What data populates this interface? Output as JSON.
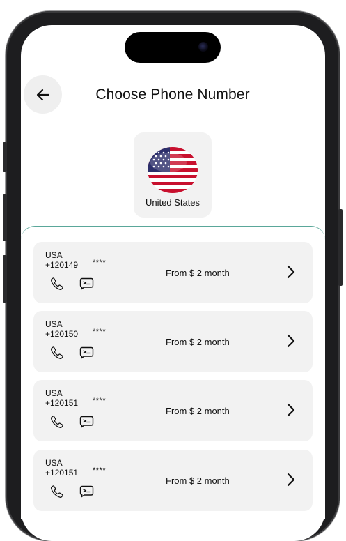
{
  "header": {
    "title": "Choose Phone Number"
  },
  "country": {
    "name": "United States"
  },
  "numbers": [
    {
      "country": "USA",
      "number": "+120149",
      "mask": "****",
      "price": "From $ 2 month"
    },
    {
      "country": "USA",
      "number": "+120150",
      "mask": "****",
      "price": "From $ 2 month"
    },
    {
      "country": "USA",
      "number": "+120151",
      "mask": "****",
      "price": "From $ 2 month"
    },
    {
      "country": "USA",
      "number": "+120151",
      "mask": "****",
      "price": "From $ 2 month"
    }
  ],
  "colors": {
    "card_bg": "#f2f2f2",
    "divider_accent": "#5aa79a",
    "flag_red": "#c8102e",
    "flag_blue": "#2c2f6b"
  }
}
